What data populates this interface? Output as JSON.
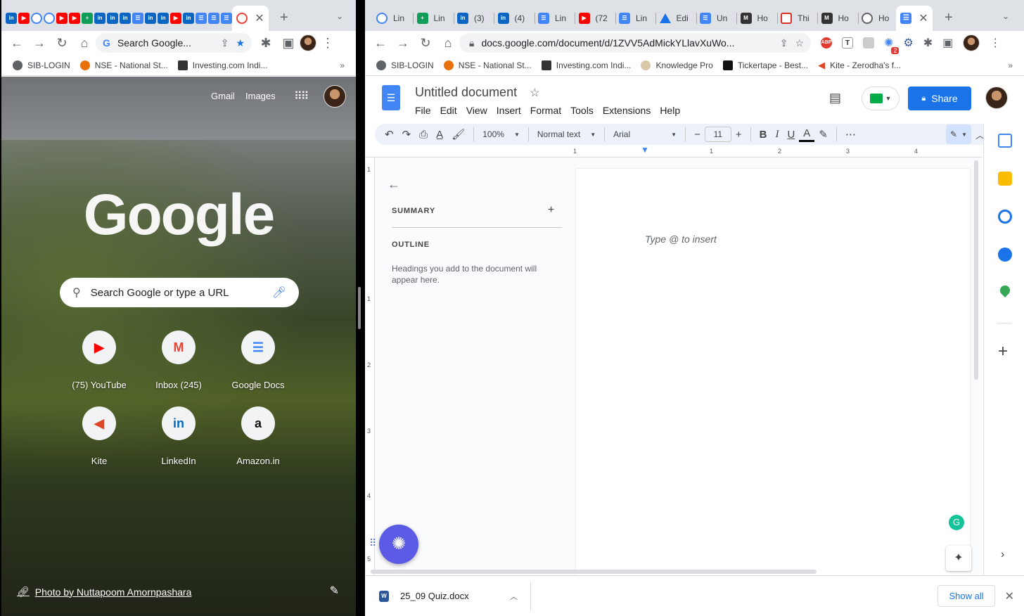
{
  "left_window": {
    "active_tab_icon": "google-chrome-icon",
    "tab_favicons": [
      "linkedin-icon",
      "youtube-icon",
      "chrome-icon",
      "chrome-icon",
      "youtube-icon",
      "youtube-icon",
      "sheets-icon",
      "linkedin-icon",
      "linkedin-icon",
      "linkedin-icon",
      "docs-icon",
      "linkedin-icon",
      "linkedin-icon",
      "youtube-icon",
      "linkedin-icon",
      "docs-icon",
      "docs-icon",
      "docs-icon",
      "dark-icon",
      "red-icon"
    ],
    "omnibox_text": "Search Google...",
    "bookmarks": [
      "SIB-LOGIN",
      "NSE - National St...",
      "Investing.com Indi..."
    ],
    "ntp": {
      "gmail": "Gmail",
      "images": "Images",
      "logo": "Google",
      "search_placeholder": "Search Google or type a URL",
      "shortcuts": [
        {
          "label": "(75) YouTube",
          "icon": "youtube-icon"
        },
        {
          "label": "Inbox (245)",
          "icon": "gmail-icon"
        },
        {
          "label": "Google Docs",
          "icon": "docs-icon"
        },
        {
          "label": "Kite",
          "icon": "kite-icon"
        },
        {
          "label": "LinkedIn",
          "icon": "linkedin-icon"
        },
        {
          "label": "Amazon.in",
          "icon": "amazon-icon"
        }
      ],
      "photo_credit": "Photo by Nuttapoom Amornpashara"
    }
  },
  "right_window": {
    "tabs": [
      {
        "title": "Lin",
        "icon": "chrome-icon"
      },
      {
        "title": "Lin",
        "icon": "sheets-icon"
      },
      {
        "title": "(3)",
        "icon": "linkedin-icon"
      },
      {
        "title": "(4)",
        "icon": "linkedin-icon"
      },
      {
        "title": "Lin",
        "icon": "docs-icon"
      },
      {
        "title": "(72",
        "icon": "youtube-icon"
      },
      {
        "title": "Lin",
        "icon": "docs-icon"
      },
      {
        "title": "Edi",
        "icon": "drive-icon"
      },
      {
        "title": "Un",
        "icon": "docs-icon"
      },
      {
        "title": "Ho",
        "icon": "dark-icon"
      },
      {
        "title": "Thi",
        "icon": "red-icon"
      },
      {
        "title": "Ho",
        "icon": "dark-icon"
      },
      {
        "title": "Ho",
        "icon": "globe-icon"
      }
    ],
    "url": "docs.google.com/document/d/1ZVV5AdMickYLlavXuWo...",
    "ext_badge": "2",
    "bookmarks": [
      "SIB-LOGIN",
      "NSE - National St...",
      "Investing.com Indi...",
      "Knowledge Pro",
      "Tickertape - Best...",
      "Kite - Zerodha's f..."
    ],
    "doc": {
      "title": "Untitled document",
      "menu": [
        "File",
        "Edit",
        "View",
        "Insert",
        "Format",
        "Tools",
        "Extensions",
        "Help"
      ],
      "share": "Share",
      "zoom": "100%",
      "style": "Normal text",
      "font": "Arial",
      "font_size": "11",
      "ruler_marks": [
        "1",
        "1",
        "2",
        "3",
        "4"
      ],
      "vruler_marks": [
        "1",
        "1",
        "2",
        "3",
        "4",
        "5"
      ],
      "summary": "SUMMARY",
      "outline": "OUTLINE",
      "outline_hint": "Headings you add to the document will appear here.",
      "body_placeholder": "Type @ to insert"
    },
    "download": {
      "file": "25_09 Quiz.docx",
      "show_all": "Show all"
    }
  }
}
